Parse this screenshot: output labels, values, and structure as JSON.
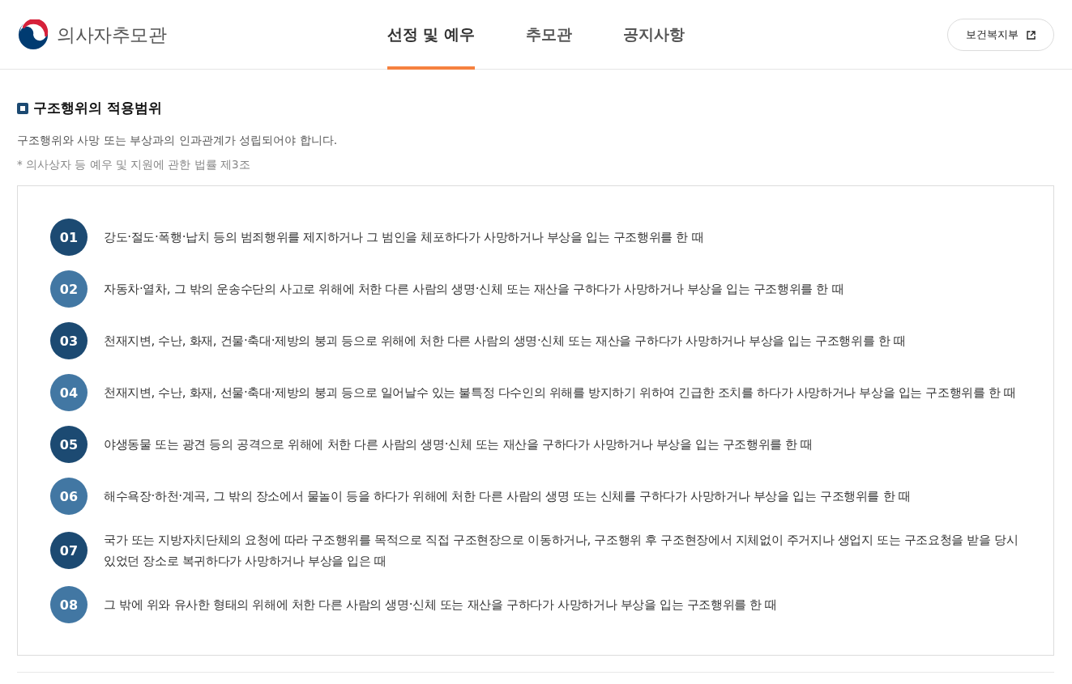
{
  "header": {
    "logo_text": "의사자추모관",
    "nav": [
      {
        "label": "선정 및 예우",
        "selected": true
      },
      {
        "label": "추모관",
        "selected": false
      },
      {
        "label": "공지사항",
        "selected": false
      }
    ],
    "external_link": {
      "label": "보건복지부"
    }
  },
  "section": {
    "title": "구조행위의 적용범위",
    "description": "구조행위와 사망 또는 부상과의 인과관계가 성립되어야 합니다.",
    "note": "* 의사상자 등 예우 및 지원에 관한 법률 제3조",
    "items": [
      {
        "number": "01",
        "text": "강도·절도·폭행·납치 등의 범죄행위를 제지하거나 그 범인을 체포하다가 사망하거나 부상을 입는 구조행위를 한 때"
      },
      {
        "number": "02",
        "text": "자동차·열차, 그 밖의 운송수단의 사고로 위해에 처한 다른 사람의 생명·신체 또는 재산을 구하다가 사망하거나 부상을 입는 구조행위를 한 때"
      },
      {
        "number": "03",
        "text": "천재지변, 수난, 화재, 건물·축대·제방의 붕괴 등으로 위해에 처한 다른 사람의 생명·신체 또는 재산을 구하다가 사망하거나 부상을 입는 구조행위를 한 때"
      },
      {
        "number": "04",
        "text": "천재지변, 수난, 화재, 선물·축대·제방의 붕괴 등으로 일어날수 있는 불특정 다수인의 위해를 방지하기 위하여 긴급한 조치를 하다가 사망하거나 부상을 입는 구조행위를 한 때"
      },
      {
        "number": "05",
        "text": "야생동물 또는 광견 등의 공격으로 위해에 처한 다른 사람의 생명·신체 또는 재산을 구하다가 사망하거나 부상을 입는 구조행위를 한 때"
      },
      {
        "number": "06",
        "text": "해수욕장·하천·계곡, 그 밖의 장소에서 물놀이 등을 하다가 위해에 처한 다른 사람의 생명 또는 신체를 구하다가 사망하거나 부상을 입는 구조행위를 한 때"
      },
      {
        "number": "07",
        "text": "국가 또는 지방자치단체의 요청에 따라 구조행위를 목적으로 직접 구조현장으로 이동하거나, 구조행위 후 구조현장에서 지체없이 주거지나 생업지 또는 구조요청을 받을 당시 있었던 장소로 복귀하다가 사망하거나 부상을 입은 때"
      },
      {
        "number": "08",
        "text": "그 밖에 위와 유사한 형태의 위해에 처한 다른 사람의 생명·신체 또는 재산을 구하다가 사망하거나 부상을 입는 구조행위를 한 때"
      }
    ]
  }
}
